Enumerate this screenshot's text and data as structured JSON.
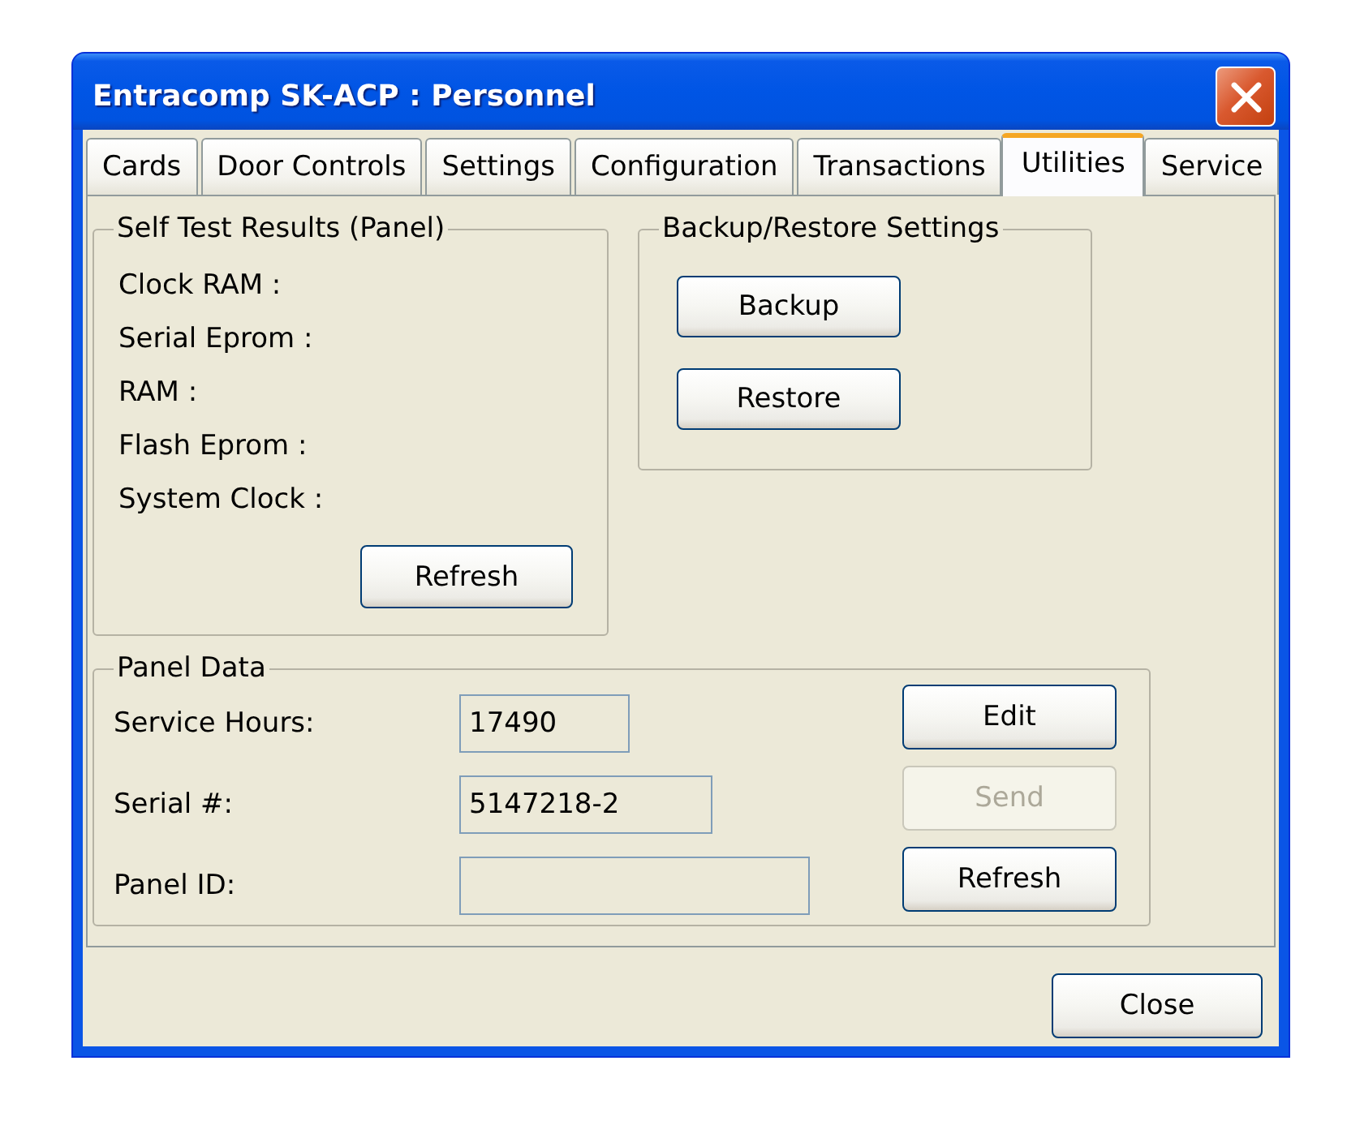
{
  "window": {
    "title": "Entracomp SK-ACP : Personnel"
  },
  "tabs": [
    {
      "label": "Cards",
      "selected": false
    },
    {
      "label": "Door Controls",
      "selected": false
    },
    {
      "label": "Settings",
      "selected": false
    },
    {
      "label": "Configuration",
      "selected": false
    },
    {
      "label": "Transactions",
      "selected": false
    },
    {
      "label": "Utilities",
      "selected": true
    },
    {
      "label": "Service",
      "selected": false
    }
  ],
  "self_test": {
    "title": "Self Test Results (Panel)",
    "items": [
      "Clock RAM :",
      "Serial Eprom :",
      "RAM :",
      "Flash Eprom :",
      "System Clock :"
    ],
    "refresh_button": "Refresh"
  },
  "backup_restore": {
    "title": "Backup/Restore Settings",
    "buttons": [
      "Backup",
      "Restore"
    ]
  },
  "panel_data": {
    "title": "Panel Data",
    "fields": [
      {
        "label": "Service Hours:",
        "value": "17490"
      },
      {
        "label": "Serial #:",
        "value": "5147218-2"
      },
      {
        "label": "Panel ID:"
      }
    ],
    "buttons": [
      {
        "label": "Edit",
        "disabled": false
      },
      {
        "label": "Send",
        "disabled": true
      },
      {
        "label": "Refresh",
        "disabled": false
      }
    ]
  },
  "footer": {
    "buttons": [
      "Close"
    ]
  }
}
